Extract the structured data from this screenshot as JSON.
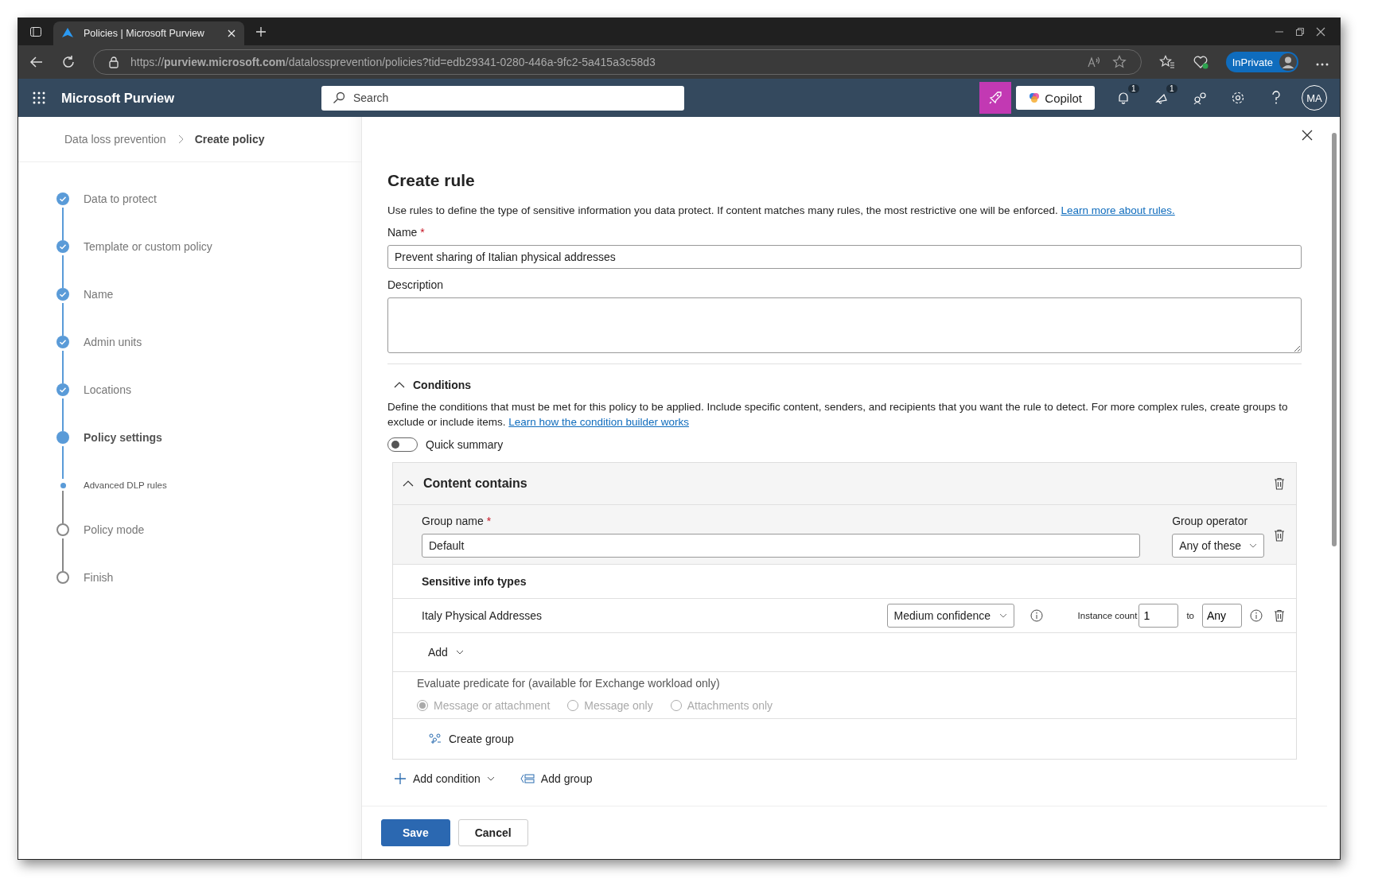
{
  "browser": {
    "tab_title": "Policies | Microsoft Purview",
    "url": "https://**purview.microsoft.com**/datalossprevention/policies?tid=edb29341-0280-446a-9fc2-5a415a3c58d3",
    "inprivate": "InPrivate"
  },
  "header": {
    "app_name": "Microsoft Purview",
    "search_placeholder": "Search",
    "copilot": "Copilot",
    "notification_count": "1",
    "announcement_count": "1",
    "avatar": "MA"
  },
  "breadcrumb": [
    {
      "label": "Data loss prevention",
      "selected": false
    },
    {
      "label": "Create policy",
      "selected": true
    }
  ],
  "steps": [
    {
      "label": "Data to protect",
      "kind": "step",
      "completed": true,
      "selected": false
    },
    {
      "label": "Template or custom policy",
      "kind": "step",
      "completed": true,
      "selected": false
    },
    {
      "label": "Name",
      "kind": "step",
      "completed": true,
      "selected": false
    },
    {
      "label": "Admin units",
      "kind": "step",
      "completed": true,
      "selected": false
    },
    {
      "label": "Locations",
      "kind": "step",
      "completed": true,
      "selected": false
    },
    {
      "label": "Policy settings",
      "kind": "step",
      "completed": false,
      "selected": true
    },
    {
      "label": "Advanced DLP rules",
      "kind": "substep",
      "completed": false,
      "selected": true
    },
    {
      "label": "Policy mode",
      "kind": "step",
      "completed": false,
      "selected": false
    },
    {
      "label": "Finish",
      "kind": "step",
      "completed": false,
      "selected": false
    }
  ],
  "panel": {
    "title": "Create rule",
    "intro": "Use rules to define the type of sensitive information you data protect. If content matches many rules, the most restrictive one will be enforced.",
    "intro_link": "Learn more about rules.",
    "name_label": "Name",
    "name_required_mark": "*",
    "name_value": "Prevent sharing of Italian physical addresses",
    "description_label": "Description",
    "conditions": {
      "title": "Conditions",
      "expanded": true,
      "text": "Define the conditions that must be met for this policy to be applied. Include specific content, senders, and recipients that you want the rule to detect. For more complex rules, create groups to exclude or include items.",
      "link": "Learn how the condition builder works",
      "quick_summary": {
        "label": "Quick summary",
        "on": false
      },
      "group": {
        "title": "Content contains",
        "expanded": true,
        "group_name_label": "Group name",
        "group_name_required_mark": "*",
        "group_name_value": "Default",
        "operator_label": "Group operator",
        "operator_value": "Any of these",
        "section_title": "Sensitive info types",
        "items": [
          {
            "name": "Italy Physical Addresses",
            "confidence": "Medium confidence",
            "instance_label": "Instance count",
            "min": "1",
            "to": "to",
            "max": "Any"
          }
        ],
        "add": "Add",
        "evaluate_label": "Evaluate predicate for (available for Exchange workload only)",
        "evaluate_options": [
          {
            "label": "Message or attachment",
            "selected": true,
            "disabled": true
          },
          {
            "label": "Message only",
            "selected": false,
            "disabled": true
          },
          {
            "label": "Attachments only",
            "selected": false,
            "disabled": true
          }
        ],
        "create_group": "Create group"
      },
      "add_condition": "Add condition",
      "add_group": "Add group"
    },
    "buttons": [
      {
        "label": "Save",
        "kind": "primary"
      },
      {
        "label": "Cancel",
        "kind": "secondary"
      }
    ]
  }
}
